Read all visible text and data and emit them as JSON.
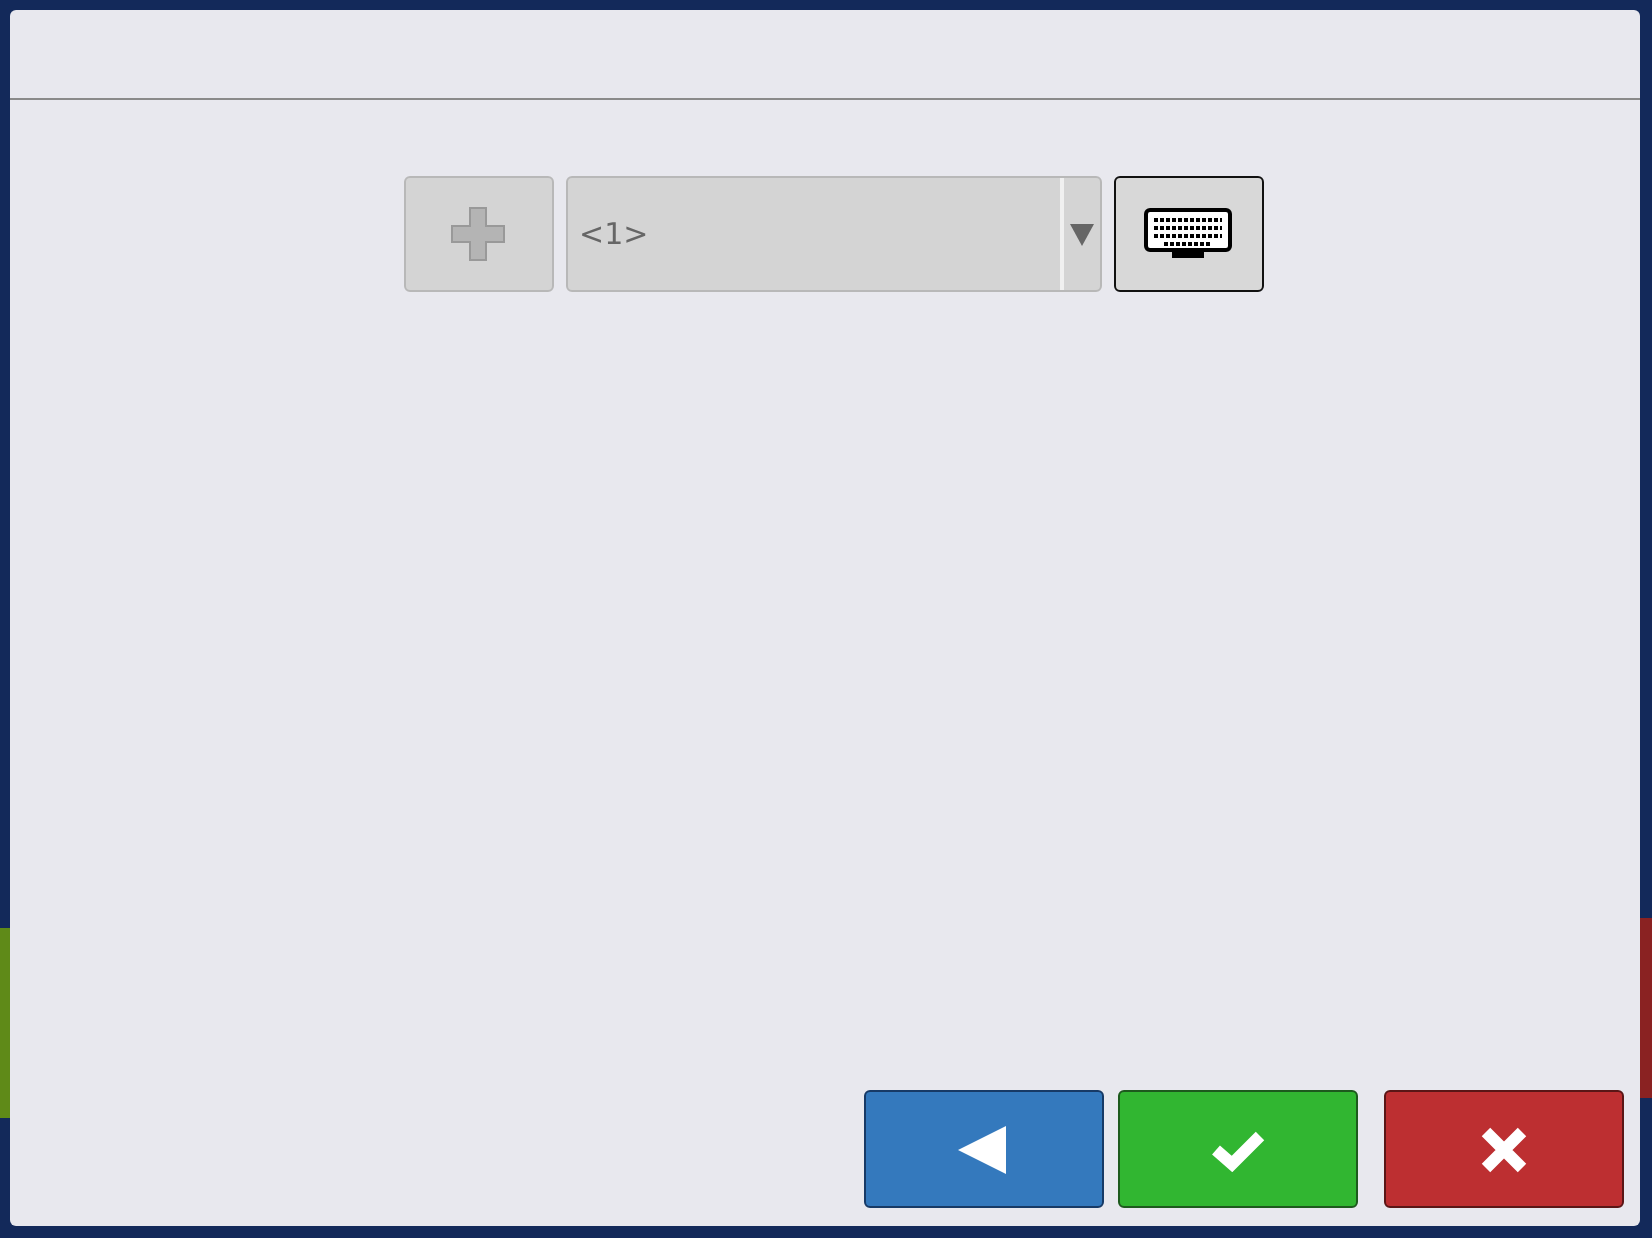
{
  "add_button": {
    "disabled": true
  },
  "selector": {
    "value": "<1>"
  },
  "actions": [
    {
      "kind": "back"
    },
    {
      "kind": "confirm"
    },
    {
      "kind": "cancel"
    }
  ]
}
